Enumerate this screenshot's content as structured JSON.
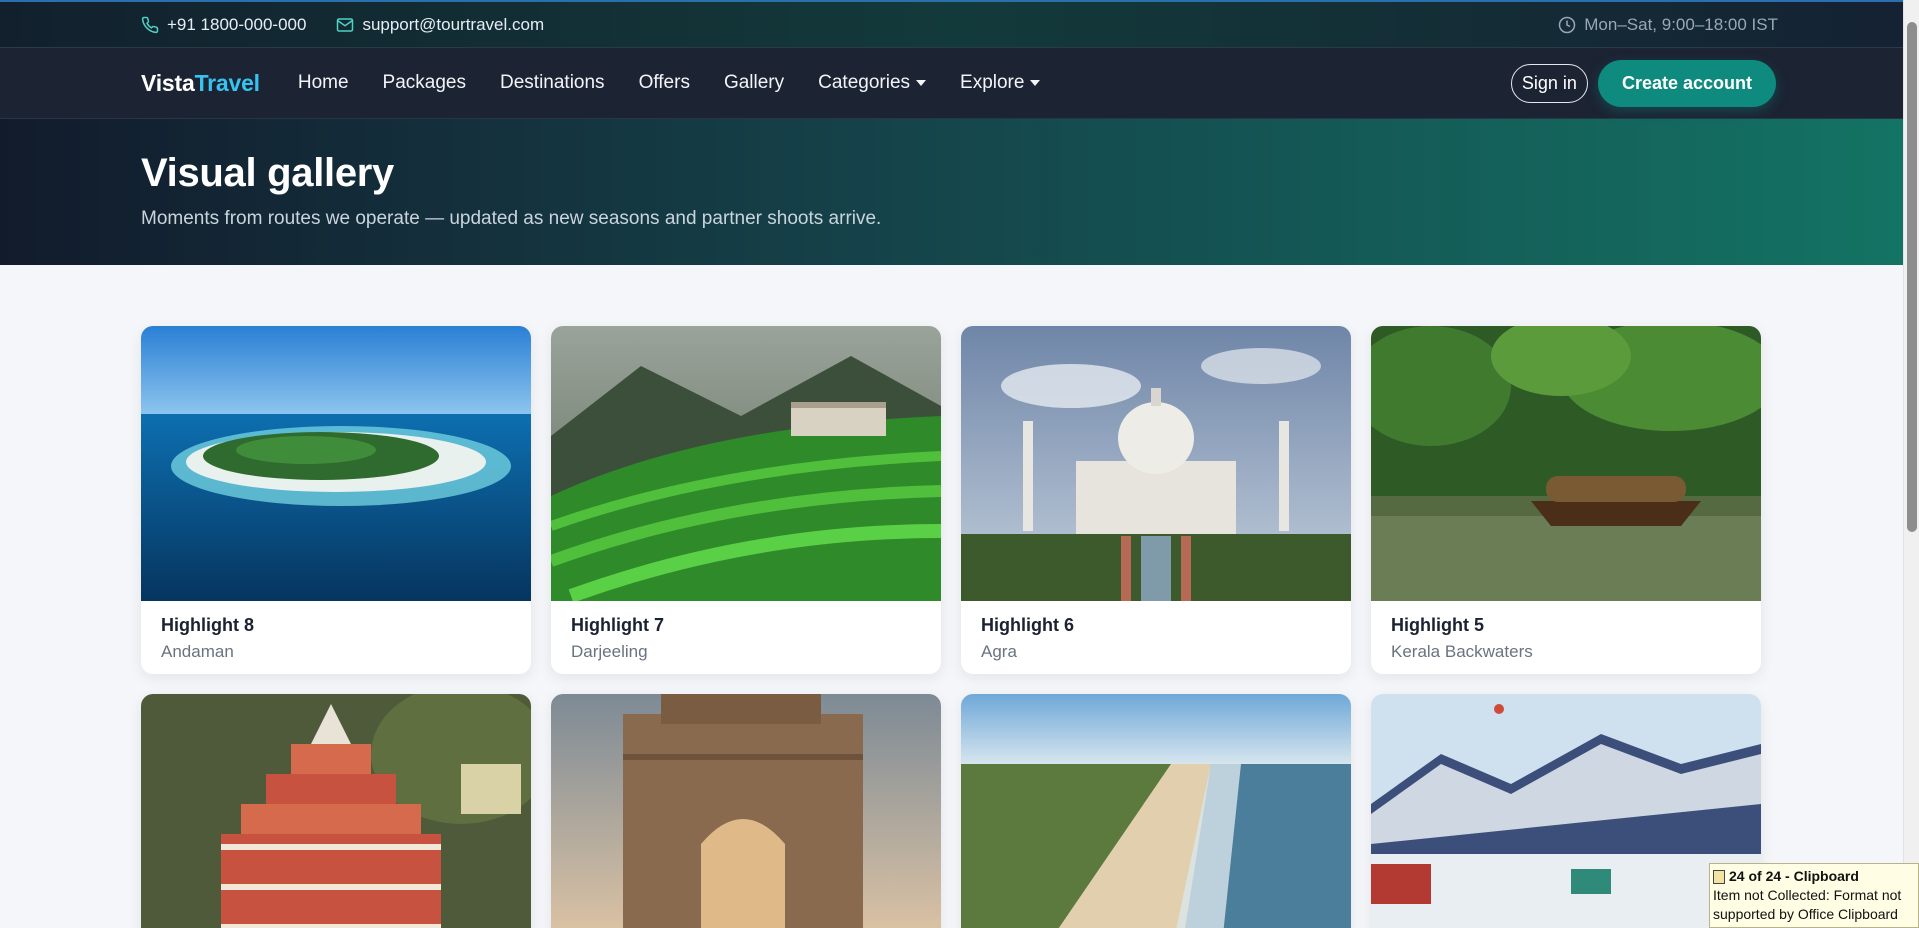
{
  "topbar": {
    "phone": "+91 1800-000-000",
    "email": "support@tourtravel.com",
    "hours": "Mon–Sat, 9:00–18:00 IST"
  },
  "navbar": {
    "brand_primary": "Vista",
    "brand_accent": "Travel",
    "items": [
      {
        "label": "Home"
      },
      {
        "label": "Packages"
      },
      {
        "label": "Destinations"
      },
      {
        "label": "Offers"
      },
      {
        "label": "Gallery"
      },
      {
        "label": "Categories",
        "dropdown": true
      },
      {
        "label": "Explore",
        "dropdown": true
      }
    ],
    "signin_label": "Sign in",
    "create_label": "Create account"
  },
  "hero": {
    "title": "Visual gallery",
    "subtitle": "Moments from routes we operate — updated as new seasons and partner shoots arrive."
  },
  "gallery": {
    "items": [
      {
        "title": "Highlight 8",
        "place": "Andaman"
      },
      {
        "title": "Highlight 7",
        "place": "Darjeeling"
      },
      {
        "title": "Highlight 6",
        "place": "Agra"
      },
      {
        "title": "Highlight 5",
        "place": "Kerala Backwaters"
      }
    ]
  },
  "toast": {
    "title": "24 of 24 - Clipboard",
    "line1": "Item not Collected: Format not",
    "line2": "supported by Office Clipboard"
  },
  "colors": {
    "accent": "#36c3f0",
    "primary_button": "#0f8a7e",
    "navbar_bg": "#1c2333"
  }
}
